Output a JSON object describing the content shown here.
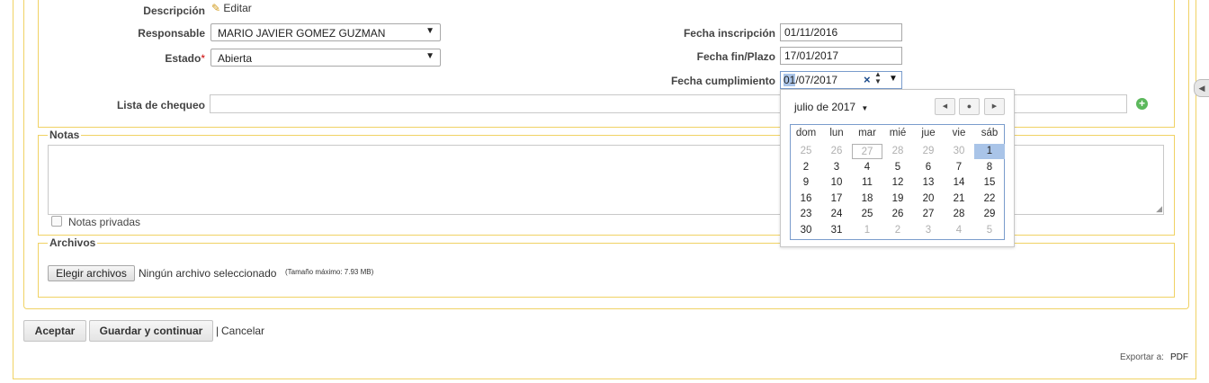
{
  "form": {
    "descripcion_label": "Descripción",
    "editar_label": "Editar",
    "responsable_label": "Responsable",
    "responsable_value": "MARIO JAVIER GOMEZ GUZMAN",
    "estado_label": "Estado",
    "estado_required": "*",
    "estado_value": "Abierta",
    "fecha_inscripcion_label": "Fecha inscripción",
    "fecha_inscripcion_value": "01/11/2016",
    "fecha_fin_label": "Fecha fin/Plazo",
    "fecha_fin_value": "17/01/2017",
    "fecha_cumplimiento_label": "Fecha cumplimiento",
    "fecha_cumplimiento_day": "01",
    "fecha_cumplimiento_rest": "/07/2017",
    "lista_chequeo_label": "Lista de chequeo"
  },
  "notas": {
    "legend": "Notas",
    "privadas_label": "Notas privadas"
  },
  "archivos": {
    "legend": "Archivos",
    "choose_button": "Elegir archivos",
    "no_file": "Ningún archivo seleccionado",
    "max_size": "(Tamaño máximo: 7.93 MB)"
  },
  "actions": {
    "aceptar": "Aceptar",
    "guardar": "Guardar y continuar",
    "separator": "|",
    "cancelar": "Cancelar"
  },
  "footer": {
    "exportar": "Exportar a:",
    "pdf": "PDF"
  },
  "calendar": {
    "month_label": "julio de 2017",
    "weekdays": [
      "dom",
      "lun",
      "mar",
      "mié",
      "jue",
      "vie",
      "sáb"
    ],
    "weeks": [
      [
        "25",
        "26",
        "27",
        "28",
        "29",
        "30",
        "1"
      ],
      [
        "2",
        "3",
        "4",
        "5",
        "6",
        "7",
        "8"
      ],
      [
        "9",
        "10",
        "11",
        "12",
        "13",
        "14",
        "15"
      ],
      [
        "16",
        "17",
        "18",
        "19",
        "20",
        "21",
        "22"
      ],
      [
        "23",
        "24",
        "25",
        "26",
        "27",
        "28",
        "29"
      ],
      [
        "30",
        "31",
        "1",
        "2",
        "3",
        "4",
        "5"
      ]
    ],
    "selected_day": "1",
    "today_marker_day": "27",
    "colors": {
      "selected_bg": "#a9c4e8",
      "other_month": "#b0b0b0",
      "accent_border": "#7a9ccc"
    }
  },
  "colors": {
    "frame": "#f0d264",
    "add_icon": "#5cb85c"
  }
}
